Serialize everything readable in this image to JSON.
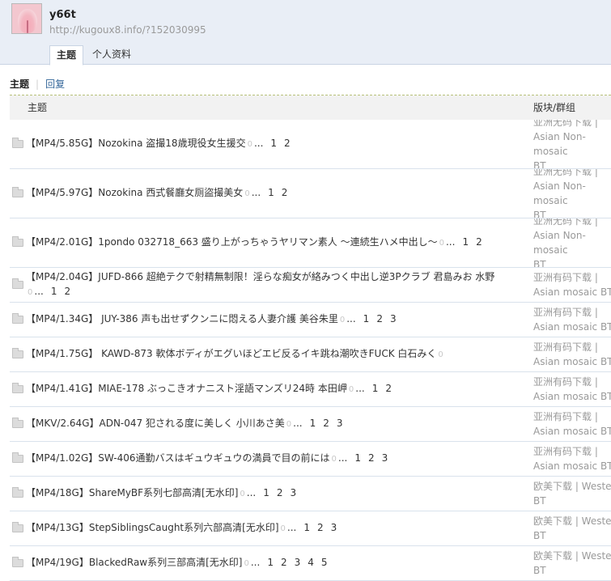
{
  "user": {
    "name": "y66t",
    "url": "http://kugoux8.info/?152030995"
  },
  "tabs": [
    {
      "label": "主题"
    },
    {
      "label": "个人资料"
    }
  ],
  "subnav": {
    "current": "主题",
    "reply": "回复"
  },
  "table_header": {
    "subject": "主题",
    "forum": "版块/群组"
  },
  "ellipsis": "...",
  "rows": [
    {
      "title": "【MP4/5.85G】Nozokina 盗撮18歳現役女生援交",
      "pages": [
        "1",
        "2"
      ],
      "forum_l1": "亚洲无码下载 |",
      "forum_l2": "Asian Non-mosaic",
      "forum_l3": "BT"
    },
    {
      "title": "【MP4/5.97G】Nozokina 西式餐廳女厕盜撮美女",
      "pages": [
        "1",
        "2"
      ],
      "forum_l1": "亚洲无码下载 |",
      "forum_l2": "Asian Non-mosaic",
      "forum_l3": "BT"
    },
    {
      "title": "【MP4/2.01G】1pondo 032718_663 盛り上がっちゃうヤリマン素人 ～連続生ハメ中出し～",
      "pages": [
        "1",
        "2"
      ],
      "forum_l1": "亚洲无码下载 |",
      "forum_l2": "Asian Non-mosaic",
      "forum_l3": "BT"
    },
    {
      "title": "【MP4/2.04G】JUFD-866 超絶テクで射精無制限！淫らな痴女が絡みつく中出し逆3Pクラブ 君島みお 水野",
      "pages": [
        "1",
        "2"
      ],
      "forum_l1": "亚洲有码下载 |",
      "forum_l2": "Asian mosaic BT",
      "forum_l3": ""
    },
    {
      "title": "【MP4/1.34G】 JUY-386 声も出せずクンニに悶える人妻介護 美谷朱里",
      "pages": [
        "1",
        "2",
        "3"
      ],
      "forum_l1": "亚洲有码下载 |",
      "forum_l2": "Asian mosaic BT",
      "forum_l3": ""
    },
    {
      "title": "【MP4/1.75G】 KAWD-873 軟体ボディがエグいほどエビ反るイキ跳ね潮吹きFUCK 白石みく",
      "pages": [],
      "forum_l1": "亚洲有码下载 |",
      "forum_l2": "Asian mosaic BT",
      "forum_l3": ""
    },
    {
      "title": "【MP4/1.41G】MIAE-178 ぶっこきオナニスト淫語マンズリ24時 本田岬",
      "pages": [
        "1",
        "2"
      ],
      "forum_l1": "亚洲有码下载 |",
      "forum_l2": "Asian mosaic BT",
      "forum_l3": ""
    },
    {
      "title": "【MKV/2.64G】ADN-047 犯される度に美しく 小川あさ美",
      "pages": [
        "1",
        "2",
        "3"
      ],
      "forum_l1": "亚洲有码下载 |",
      "forum_l2": "Asian mosaic BT",
      "forum_l3": ""
    },
    {
      "title": "【MP4/1.02G】SW-406通勤バスはギュウギュウの満員で目の前には",
      "pages": [
        "1",
        "2",
        "3"
      ],
      "forum_l1": "亚洲有码下载 |",
      "forum_l2": "Asian mosaic BT",
      "forum_l3": ""
    },
    {
      "title": "【MP4/18G】ShareMyBF系列七部高清[无水印]",
      "pages": [
        "1",
        "2",
        "3"
      ],
      "forum_l1": "欧美下载 | Weste",
      "forum_l2": "BT",
      "forum_l3": ""
    },
    {
      "title": "【MP4/13G】StepSiblingsCaught系列六部高清[无水印]",
      "pages": [
        "1",
        "2",
        "3"
      ],
      "forum_l1": "欧美下载 | Weste",
      "forum_l2": "BT",
      "forum_l3": ""
    },
    {
      "title": "【MP4/19G】BlackedRaw系列三部高清[无水印]",
      "pages": [
        "1",
        "2",
        "3",
        "4",
        "5"
      ],
      "forum_l1": "欧美下载 | Weste",
      "forum_l2": "BT",
      "forum_l3": ""
    }
  ],
  "row_heights": [
    61,
    61,
    61,
    43,
    43,
    43,
    43,
    43,
    43,
    43,
    43,
    43
  ]
}
